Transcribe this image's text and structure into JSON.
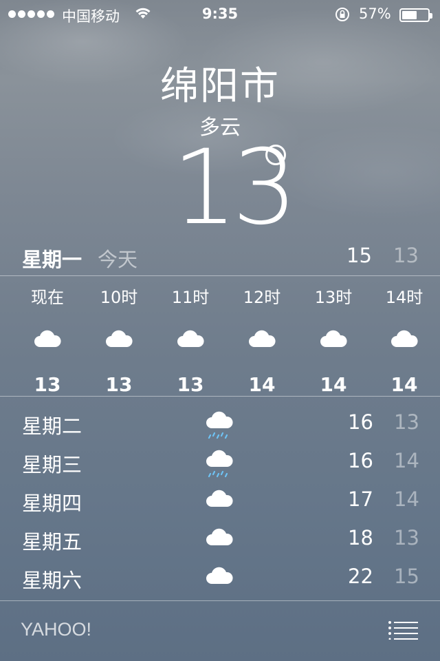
{
  "status_bar": {
    "carrier": "中国移动",
    "time": "9:35",
    "battery_percent": "57%",
    "battery_level": 0.57
  },
  "location": {
    "city": "绵阳市",
    "condition": "多云",
    "temperature": "13"
  },
  "today": {
    "day": "星期一",
    "label": "今天",
    "high": "15",
    "low": "13"
  },
  "hourly": [
    {
      "time": "现在",
      "icon": "cloud-icon",
      "temp": "13"
    },
    {
      "time": "10时",
      "icon": "cloud-icon",
      "temp": "13"
    },
    {
      "time": "11时",
      "icon": "cloud-icon",
      "temp": "13"
    },
    {
      "time": "12时",
      "icon": "cloud-icon",
      "temp": "14"
    },
    {
      "time": "13时",
      "icon": "cloud-icon",
      "temp": "14"
    },
    {
      "time": "14时",
      "icon": "cloud-icon",
      "temp": "14"
    }
  ],
  "daily": [
    {
      "day": "星期二",
      "icon": "rain-cloud-icon",
      "high": "16",
      "low": "13"
    },
    {
      "day": "星期三",
      "icon": "rain-cloud-icon",
      "high": "16",
      "low": "14"
    },
    {
      "day": "星期四",
      "icon": "cloud-icon",
      "high": "17",
      "low": "14"
    },
    {
      "day": "星期五",
      "icon": "cloud-icon",
      "high": "18",
      "low": "13"
    },
    {
      "day": "星期六",
      "icon": "cloud-icon",
      "high": "22",
      "low": "15"
    }
  ],
  "footer": {
    "provider": "YAHOO!"
  },
  "colors": {
    "rain_drops": "#6ec3f4",
    "low_temp_text": "rgba(255,255,255,0.45)"
  }
}
